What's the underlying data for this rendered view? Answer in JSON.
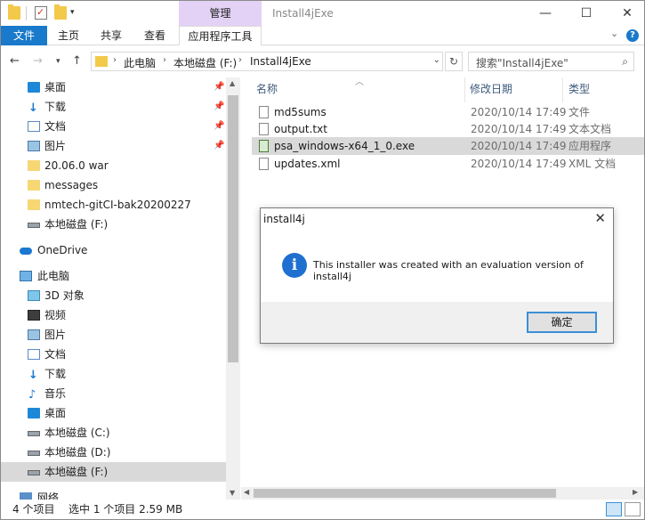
{
  "window": {
    "title": "Install4jExe",
    "manage_tab": "管理"
  },
  "ribbon": {
    "tabs": [
      "文件",
      "主页",
      "共享",
      "查看",
      "应用程序工具"
    ]
  },
  "address": {
    "crumbs": [
      "此电脑",
      "本地磁盘 (F:)",
      "Install4jExe"
    ],
    "search_placeholder": "搜索\"Install4jExe\""
  },
  "nav": {
    "items": [
      {
        "label": "桌面",
        "pinned": true
      },
      {
        "label": "下载",
        "pinned": true
      },
      {
        "label": "文档",
        "pinned": true
      },
      {
        "label": "图片",
        "pinned": true
      },
      {
        "label": "20.06.0 war"
      },
      {
        "label": "messages"
      },
      {
        "label": "nmtech-gitCI-bak20200227"
      },
      {
        "label": "本地磁盘 (F:)"
      },
      {
        "label": "OneDrive"
      },
      {
        "label": "此电脑"
      },
      {
        "label": "3D 对象"
      },
      {
        "label": "视频"
      },
      {
        "label": "图片"
      },
      {
        "label": "文档"
      },
      {
        "label": "下载"
      },
      {
        "label": "音乐"
      },
      {
        "label": "桌面"
      },
      {
        "label": "本地磁盘 (C:)"
      },
      {
        "label": "本地磁盘 (D:)"
      },
      {
        "label": "本地磁盘 (F:)",
        "selected": true
      },
      {
        "label": "网络"
      }
    ]
  },
  "columns": {
    "name": "名称",
    "date": "修改日期",
    "type": "类型"
  },
  "files": [
    {
      "name": "md5sums",
      "date": "2020/10/14 17:49",
      "type": "文件"
    },
    {
      "name": "output.txt",
      "date": "2020/10/14 17:49",
      "type": "文本文档"
    },
    {
      "name": "psa_windows-x64_1_0.exe",
      "date": "2020/10/14 17:49",
      "type": "应用程序",
      "selected": true
    },
    {
      "name": "updates.xml",
      "date": "2020/10/14 17:49",
      "type": "XML 文档"
    }
  ],
  "status": {
    "count": "4 个项目",
    "selection": "选中 1 个项目  2.59 MB"
  },
  "dialog": {
    "title": "install4j",
    "message": "This installer was created with an evaluation version of install4j",
    "ok_label": "确定"
  }
}
